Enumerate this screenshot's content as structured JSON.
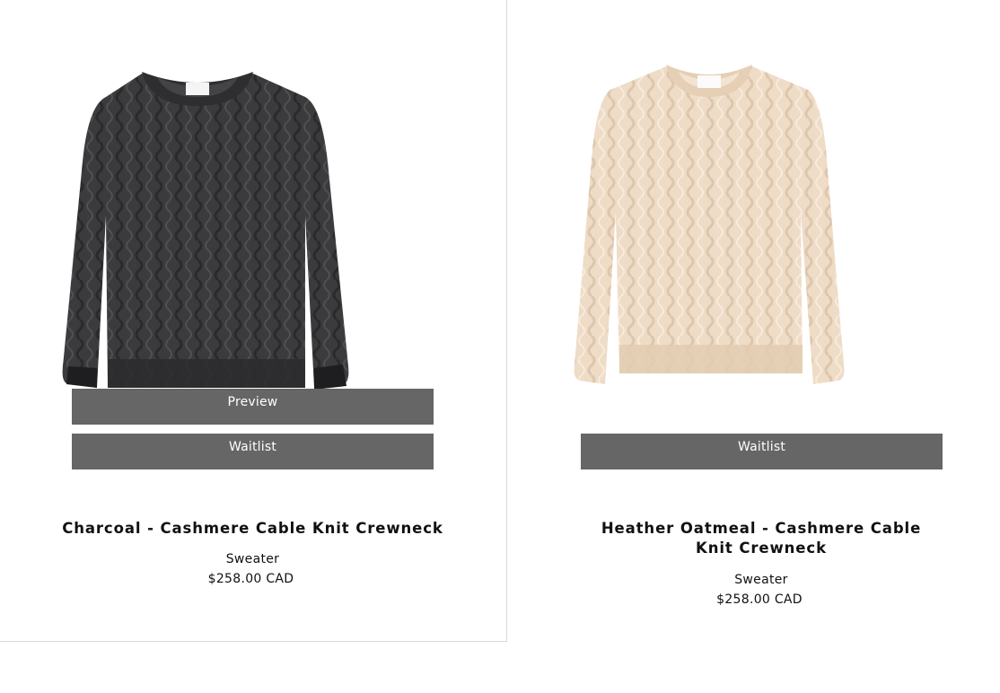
{
  "products": [
    {
      "color": "Charcoal",
      "title": "Charcoal - Cashmere Cable Knit Crewneck",
      "subtitle": "Sweater",
      "price": "$258.00 CAD",
      "preview_label": "Preview",
      "waitlist_label": "Waitlist",
      "swatch": "#3a3a3c"
    },
    {
      "color": "Heather Oatmeal",
      "title": "Heather Oatmeal - Cashmere Cable Knit Crewneck",
      "subtitle": "Sweater",
      "price": "$258.00 CAD",
      "waitlist_label": "Waitlist",
      "swatch": "#efdcc6"
    }
  ],
  "colors": {
    "button_bg": "#666666",
    "divider": "#d9d9d9"
  }
}
